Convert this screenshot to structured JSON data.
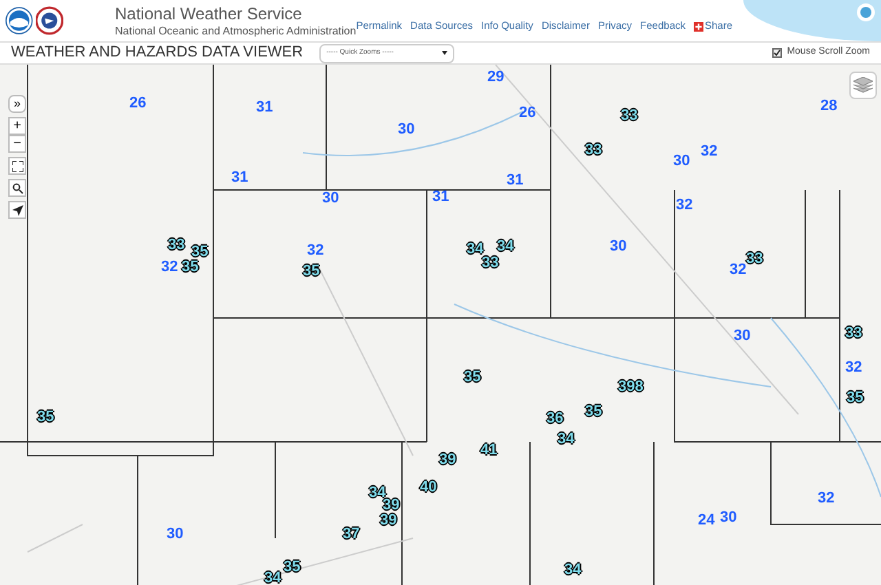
{
  "header": {
    "title": "National Weather Service",
    "subtitle": "National Oceanic and Atmospheric Administration",
    "links": [
      "Permalink",
      "Data Sources",
      "Info Quality",
      "Disclaimer",
      "Privacy",
      "Feedback"
    ],
    "share": "Share"
  },
  "toolbar": {
    "title": "WEATHER AND HAZARDS DATA VIEWER",
    "quick_zooms": "----- Quick Zooms -----",
    "mouse_scroll_zoom": {
      "label": "Mouse Scroll Zoom",
      "checked": true
    }
  },
  "map": {
    "controls": {
      "expand": "»",
      "zoom_in": "+",
      "zoom_out": "−"
    },
    "markers": [
      {
        "text": "26",
        "kind": "plain"
      },
      {
        "text": "31",
        "kind": "plain"
      },
      {
        "text": "30",
        "kind": "plain"
      },
      {
        "text": "31",
        "kind": "plain"
      },
      {
        "text": "30",
        "kind": "plain"
      },
      {
        "text": "29",
        "kind": "plain"
      },
      {
        "text": "26",
        "kind": "plain"
      },
      {
        "text": "31",
        "kind": "plain"
      },
      {
        "text": "30",
        "kind": "plain"
      },
      {
        "text": "32",
        "kind": "plain"
      },
      {
        "text": "28",
        "kind": "plain"
      },
      {
        "text": "31",
        "kind": "plain"
      },
      {
        "text": "32",
        "kind": "plain"
      },
      {
        "text": "32",
        "kind": "plain"
      },
      {
        "text": "32",
        "kind": "plain"
      },
      {
        "text": "30",
        "kind": "plain"
      },
      {
        "text": "32",
        "kind": "plain"
      },
      {
        "text": "30",
        "kind": "plain"
      },
      {
        "text": "32",
        "kind": "plain"
      },
      {
        "text": "30",
        "kind": "plain"
      },
      {
        "text": "32",
        "kind": "plain"
      },
      {
        "text": "24",
        "kind": "plain"
      },
      {
        "text": "30",
        "kind": "plain"
      },
      {
        "text": "33",
        "kind": "outlined"
      },
      {
        "text": "33",
        "kind": "outlined"
      },
      {
        "text": "33",
        "kind": "outlined"
      },
      {
        "text": "35",
        "kind": "outlined"
      },
      {
        "text": "35",
        "kind": "outlined"
      },
      {
        "text": "35",
        "kind": "outlined"
      },
      {
        "text": "34",
        "kind": "outlined"
      },
      {
        "text": "34",
        "kind": "outlined"
      },
      {
        "text": "33",
        "kind": "outlined"
      },
      {
        "text": "33",
        "kind": "outlined"
      },
      {
        "text": "33",
        "kind": "outlined"
      },
      {
        "text": "35",
        "kind": "outlined"
      },
      {
        "text": "398",
        "kind": "outlined"
      },
      {
        "text": "35",
        "kind": "outlined"
      },
      {
        "text": "36",
        "kind": "outlined"
      },
      {
        "text": "34",
        "kind": "outlined"
      },
      {
        "text": "41",
        "kind": "outlined"
      },
      {
        "text": "39",
        "kind": "outlined"
      },
      {
        "text": "35",
        "kind": "outlined"
      },
      {
        "text": "34",
        "kind": "outlined"
      },
      {
        "text": "40",
        "kind": "outlined"
      },
      {
        "text": "39",
        "kind": "outlined"
      },
      {
        "text": "39",
        "kind": "outlined"
      },
      {
        "text": "37",
        "kind": "outlined"
      },
      {
        "text": "35",
        "kind": "outlined"
      },
      {
        "text": "34",
        "kind": "outlined"
      },
      {
        "text": "34",
        "kind": "outlined"
      },
      {
        "text": "35",
        "kind": "outlined"
      }
    ]
  }
}
